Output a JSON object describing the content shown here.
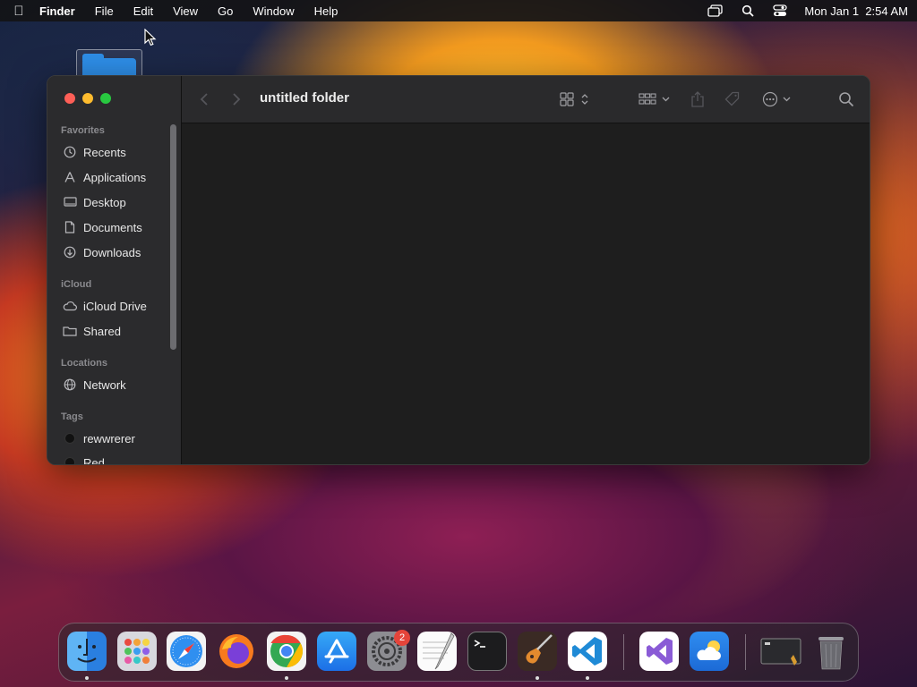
{
  "menubar": {
    "app_name": "Finder",
    "menus": [
      "File",
      "Edit",
      "View",
      "Go",
      "Window",
      "Help"
    ],
    "clock": "Mon Jan 1  2:54 AM"
  },
  "finder": {
    "title": "untitled folder",
    "sidebar": {
      "favorites_label": "Favorites",
      "favorites": [
        "Recents",
        "Applications",
        "Desktop",
        "Documents",
        "Downloads"
      ],
      "icloud_label": "iCloud",
      "icloud": [
        "iCloud Drive",
        "Shared"
      ],
      "locations_label": "Locations",
      "locations": [
        "Network"
      ],
      "tags_label": "Tags",
      "tags": [
        "rewwrerer",
        "Red"
      ]
    }
  },
  "dock": {
    "apps": [
      "Finder",
      "Launchpad",
      "Safari",
      "Firefox",
      "Chrome",
      "App Store",
      "System Settings",
      "TextEdit",
      "Terminal",
      "GarageBand",
      "Visual Studio Code",
      "Visual Studio",
      "Weather",
      "Screen Utility",
      "Trash"
    ],
    "settings_badge": "2"
  },
  "colors": {
    "accent": "#2e8ee8",
    "close": "#fe5f57",
    "minimize": "#febc2e",
    "zoom": "#28c840"
  }
}
